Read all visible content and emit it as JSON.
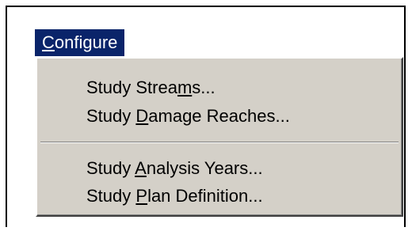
{
  "menubar": {
    "configure": {
      "before": "",
      "mnemonic": "C",
      "after": "onfigure"
    }
  },
  "menu": {
    "items": [
      {
        "before": "Study Strea",
        "mnemonic": "m",
        "after": "s..."
      },
      {
        "before": "Study ",
        "mnemonic": "D",
        "after": "amage Reaches..."
      },
      {
        "before": "Study ",
        "mnemonic": "A",
        "after": "nalysis Years..."
      },
      {
        "before": "Study ",
        "mnemonic": "P",
        "after": "lan Definition..."
      }
    ]
  }
}
